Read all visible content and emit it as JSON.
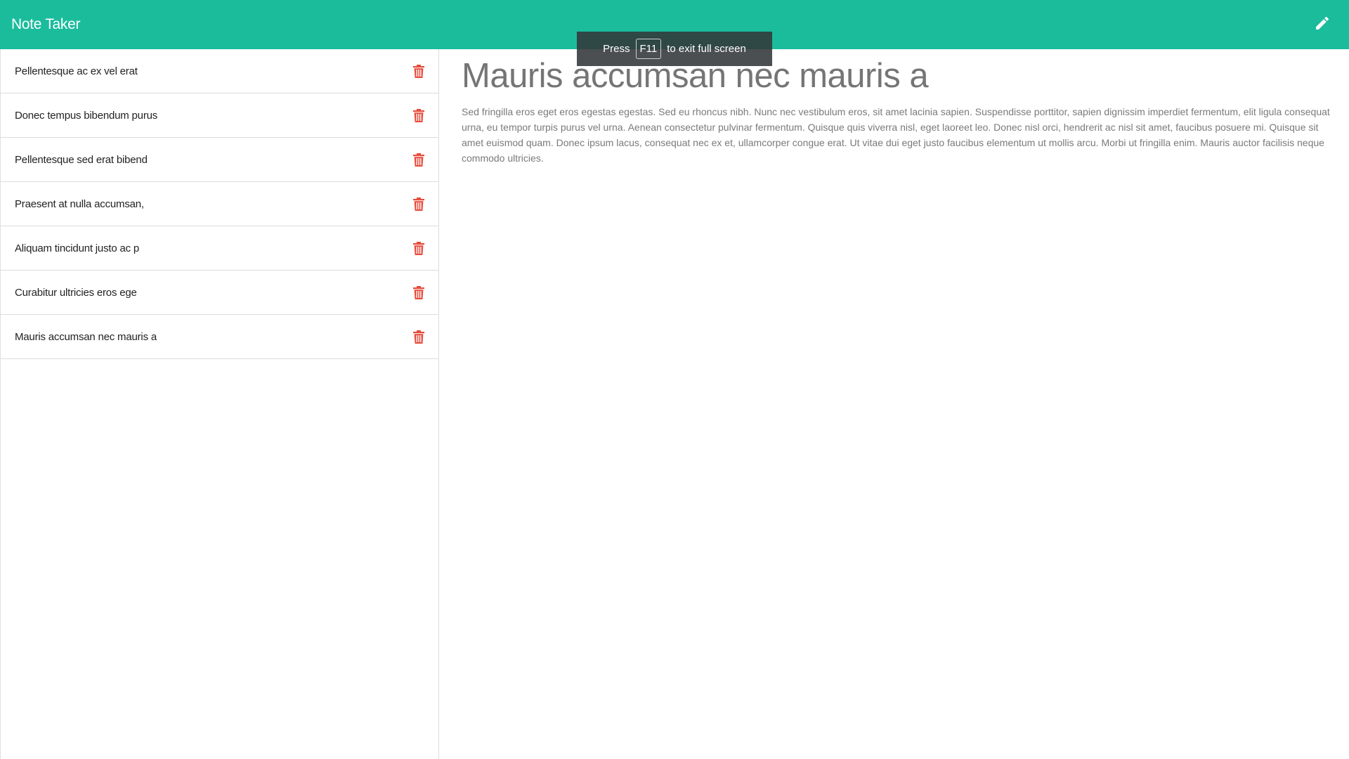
{
  "app": {
    "title": "Note Taker"
  },
  "toolbar": {
    "new_note_icon": "pencil-icon",
    "accent_color": "#1abc9c"
  },
  "fullscreen_toast": {
    "prefix": "Press",
    "key": "F11",
    "suffix": "to exit full screen"
  },
  "notes": [
    {
      "title": "Pellentesque ac ex vel erat"
    },
    {
      "title": "Donec tempus bibendum purus"
    },
    {
      "title": "Pellentesque sed erat bibend"
    },
    {
      "title": "Praesent at nulla accumsan,"
    },
    {
      "title": "Aliquam tincidunt justo ac p"
    },
    {
      "title": "Curabitur ultricies eros ege"
    },
    {
      "title": "Mauris accumsan nec mauris a"
    }
  ],
  "delete_icon": "trash-icon",
  "delete_color": "#e74c3c",
  "active_note": {
    "title": "Mauris accumsan nec mauris a",
    "body": "Sed fringilla eros eget eros egestas egestas. Sed eu rhoncus nibh. Nunc nec vestibulum eros, sit amet lacinia sapien. Suspendisse porttitor, sapien dignissim imperdiet fermentum, elit ligula consequat urna, eu tempor turpis purus vel urna. Aenean consectetur pulvinar fermentum. Quisque quis viverra nisl, eget laoreet leo. Donec nisl orci, hendrerit ac nisl sit amet, faucibus posuere mi. Quisque sit amet euismod quam. Donec ipsum lacus, consequat nec ex et, ullamcorper congue erat. Ut vitae dui eget justo faucibus elementum ut mollis arcu. Morbi ut fringilla enim. Mauris auctor facilisis neque commodo ultricies."
  }
}
